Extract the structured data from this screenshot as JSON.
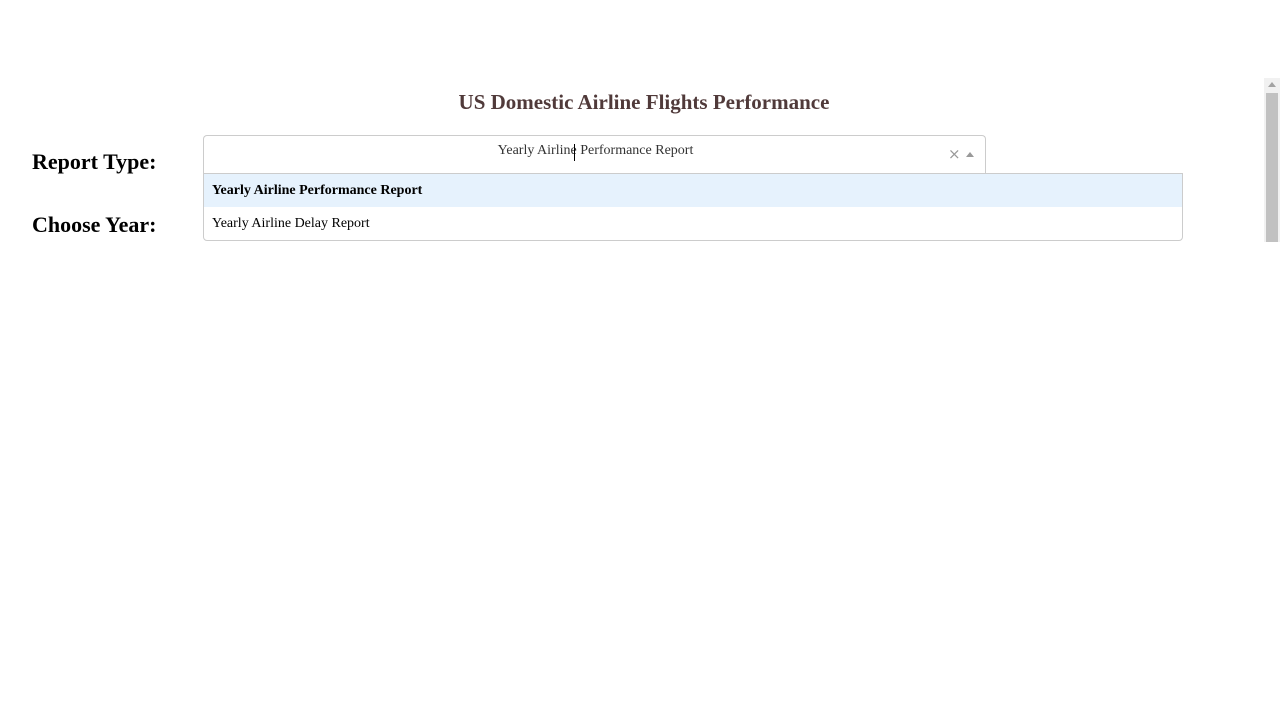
{
  "header": {
    "title": "US Domestic Airline Flights Performance"
  },
  "form": {
    "report_type_label": "Report Type:",
    "year_label": "Choose Year:",
    "report_select": {
      "value": "Yearly Airline Performance Report",
      "clear_glyph": "×",
      "options": [
        {
          "label": "Yearly Airline Performance Report",
          "selected": true
        },
        {
          "label": "Yearly Airline Delay Report",
          "selected": false
        }
      ]
    }
  },
  "colors": {
    "title": "#503a3a",
    "option_highlight": "#e6f2fd",
    "border": "#cccccc"
  },
  "icons": {
    "clear": "close-icon",
    "dropdown_toggle": "chevron-up-icon"
  }
}
